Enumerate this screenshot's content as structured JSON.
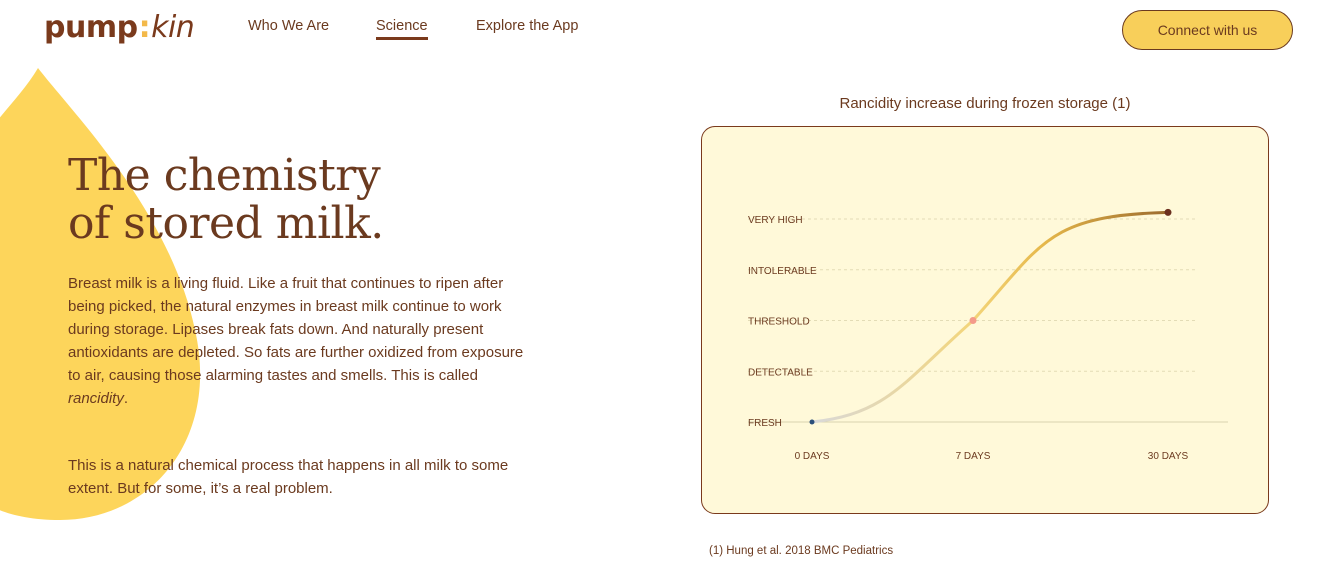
{
  "brand": {
    "logo_left": "pump",
    "logo_colon": ":",
    "logo_right": "kin"
  },
  "nav": {
    "items": [
      {
        "label": "Who We Are",
        "active": false
      },
      {
        "label": "Science",
        "active": true
      },
      {
        "label": "Explore the App",
        "active": false
      }
    ]
  },
  "cta": {
    "label": "Connect with us"
  },
  "hero": {
    "heading_line1": "The chemistry",
    "heading_line2": "of stored milk.",
    "para1_main": "Breast milk is a living fluid. Like a fruit that continues to ripen after being picked, the natural enzymes in breast milk continue to work during storage. Lipases break fats down. And naturally present antioxidants are depleted. So fats are further oxidized from exposure to air, causing those alarming tastes and smells. This is called ",
    "para1_em": "rancidity",
    "para1_end": ".",
    "para2": "This is a natural chemical process that happens in all milk to some extent. But for some, it’s a real problem."
  },
  "colors": {
    "accent_yellow": "#f8cf5a",
    "brand_brown": "#6b3a1f",
    "chart_bg": "#fff9d9"
  },
  "chart_data": {
    "type": "line",
    "title": "Rancidity increase during frozen storage (1)",
    "y_categories": [
      "FRESH",
      "DETECTABLE",
      "THRESHOLD",
      "INTOLERABLE",
      "VERY HIGH"
    ],
    "x_ticks": [
      "0 DAYS",
      "7 DAYS",
      "30 DAYS"
    ],
    "points": [
      {
        "x": "0 DAYS",
        "y_level": 0,
        "color": "#2b4f7a"
      },
      {
        "x": "7 DAYS",
        "y_level": 2,
        "color": "#f49a8a"
      },
      {
        "x": "30 DAYS",
        "y_level": 4.13,
        "color": "#6b2f1e"
      }
    ],
    "grid": true
  },
  "footnote": "(1) Hung et al. 2018 BMC Pediatrics"
}
